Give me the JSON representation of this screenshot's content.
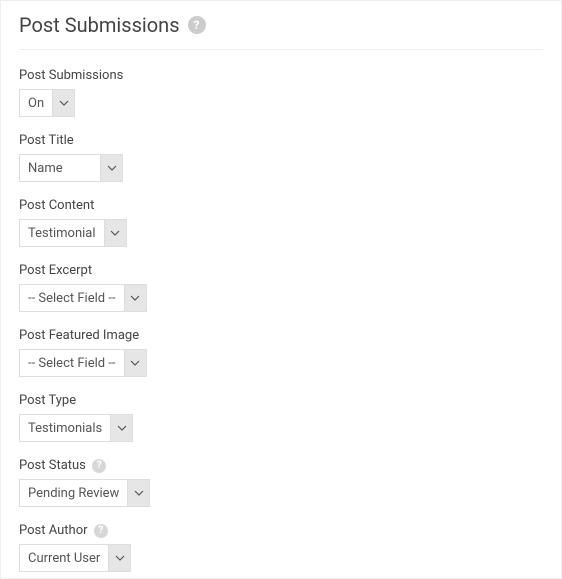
{
  "header": {
    "title": "Post Submissions"
  },
  "fields": {
    "post_submissions": {
      "label": "Post Submissions",
      "value": "On"
    },
    "post_title": {
      "label": "Post Title",
      "value": "Name"
    },
    "post_content": {
      "label": "Post Content",
      "value": "Testimonial"
    },
    "post_excerpt": {
      "label": "Post Excerpt",
      "value": "-- Select Field --"
    },
    "post_featured_image": {
      "label": "Post Featured Image",
      "value": "-- Select Field --"
    },
    "post_type": {
      "label": "Post Type",
      "value": "Testimonials"
    },
    "post_status": {
      "label": "Post Status",
      "value": "Pending Review"
    },
    "post_author": {
      "label": "Post Author",
      "value": "Current User"
    }
  }
}
